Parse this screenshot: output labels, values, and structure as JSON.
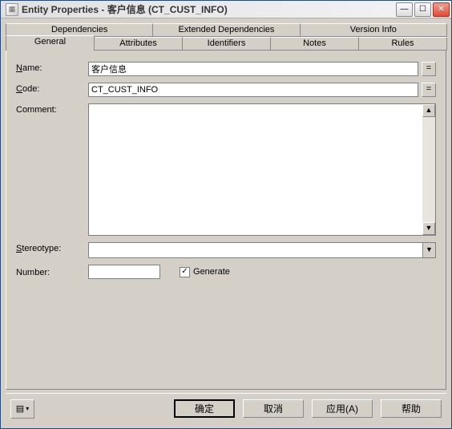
{
  "title": "Entity Properties - 客户信息 (CT_CUST_INFO)",
  "tabs_back": [
    "Dependencies",
    "Extended Dependencies",
    "Version Info"
  ],
  "tabs_front": [
    "General",
    "Attributes",
    "Identifiers",
    "Notes",
    "Rules"
  ],
  "active_tab": "General",
  "labels": {
    "name": "Name:",
    "code": "Code:",
    "comment": "Comment:",
    "stereotype": "Stereotype:",
    "number": "Number:",
    "generate": "Generate"
  },
  "values": {
    "name": "客户信息",
    "code": "CT_CUST_INFO",
    "comment": "",
    "stereotype": "",
    "number": "",
    "generate_checked": true
  },
  "buttons": {
    "ok": "确定",
    "cancel": "取消",
    "apply": "应用(A)",
    "help": "帮助"
  },
  "ellipsis_btn": "=",
  "check_glyph": "✓",
  "arrow_up": "▲",
  "arrow_down": "▼",
  "menu_glyph": "▾"
}
